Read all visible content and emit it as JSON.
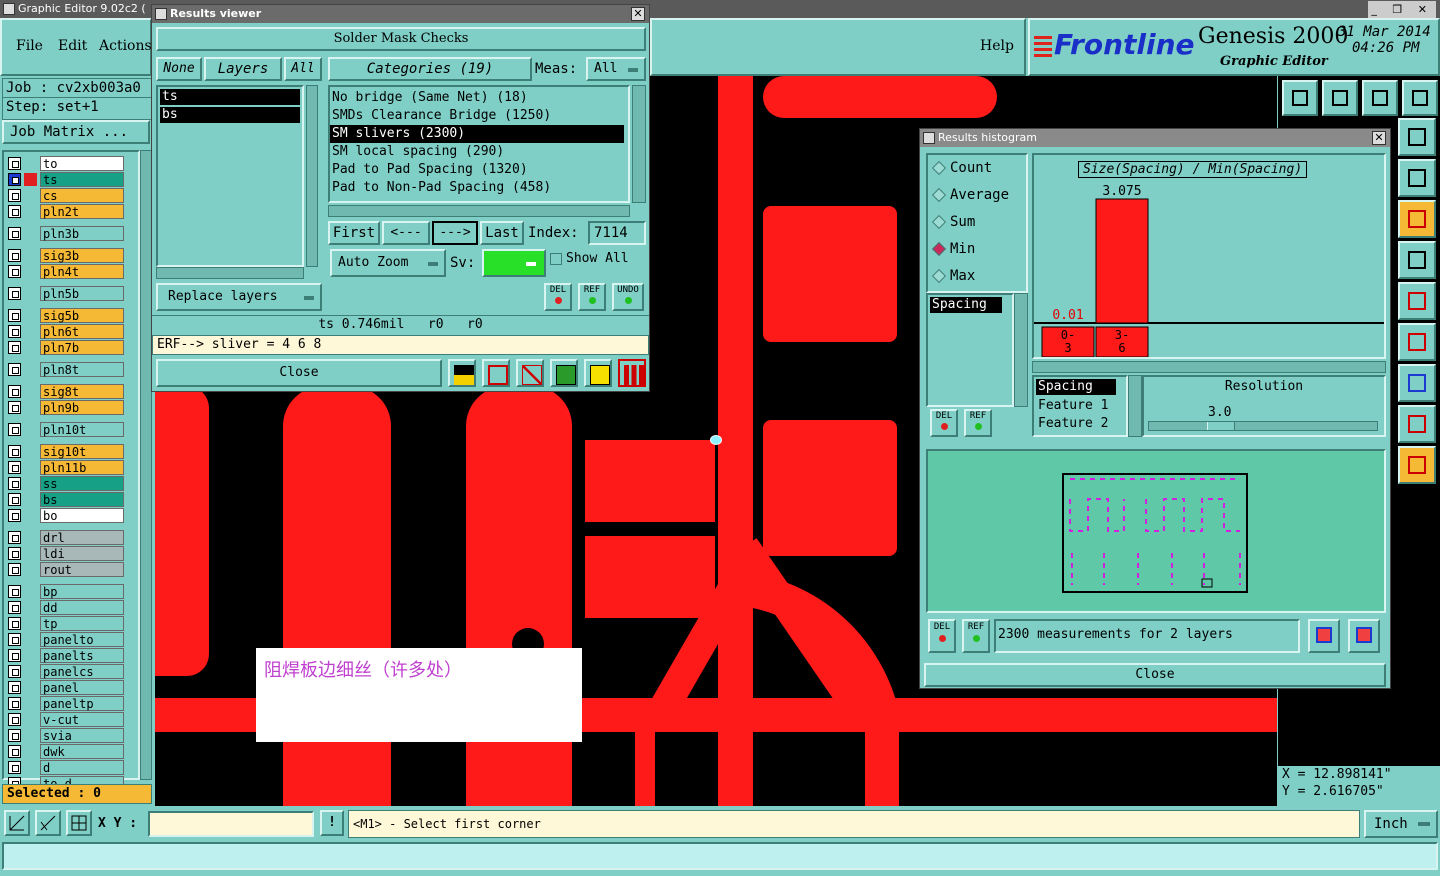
{
  "app": {
    "title": "Graphic Editor 9.02c2 (",
    "help": "Help",
    "menu": [
      "File",
      "Edit",
      "Actions"
    ],
    "job": "Job : cv2xb003a0",
    "step": "Step: set+1",
    "job_matrix": "Job Matrix ...",
    "brand": "Frontline",
    "product": "Genesis 2000",
    "subtitle": "Graphic Editor",
    "date": "31 Mar 2014",
    "time": "04:26 PM",
    "selected": "Selected : 0",
    "xy_label": "X Y :",
    "prompt": "<M1> - Select first corner",
    "unit": "Inch",
    "coord_x": "X = 12.898141\"",
    "coord_y": "Y = 2.616705\"",
    "annotation": "阻焊板边细丝（许多处）"
  },
  "layers": [
    {
      "name": "to",
      "color": "#ffffff"
    },
    {
      "name": "ts",
      "color": "#16a085"
    },
    {
      "name": "cs",
      "color": "#f5b935"
    },
    {
      "name": "pln2t",
      "color": "#f5b935"
    },
    {
      "name": "pln3b",
      "color": "#7fcfc6"
    },
    {
      "name": "sig3b",
      "color": "#f5b935"
    },
    {
      "name": "pln4t",
      "color": "#f5b935"
    },
    {
      "name": "pln5b",
      "color": "#7fcfc6"
    },
    {
      "name": "sig5b",
      "color": "#f5b935"
    },
    {
      "name": "pln6t",
      "color": "#f5b935"
    },
    {
      "name": "pln7b",
      "color": "#f5b935"
    },
    {
      "name": "pln8t",
      "color": "#7fcfc6"
    },
    {
      "name": "sig8t",
      "color": "#f5b935"
    },
    {
      "name": "pln9b",
      "color": "#f5b935"
    },
    {
      "name": "pln10t",
      "color": "#7fcfc6"
    },
    {
      "name": "sig10t",
      "color": "#f5b935"
    },
    {
      "name": "pln11b",
      "color": "#f5b935"
    },
    {
      "name": "ss",
      "color": "#16a085"
    },
    {
      "name": "bs",
      "color": "#16a085"
    },
    {
      "name": "bo",
      "color": "#ffffff"
    },
    {
      "name": "drl",
      "color": "#a8b8b8"
    },
    {
      "name": "ldi",
      "color": "#a8b8b8"
    },
    {
      "name": "rout",
      "color": "#a8b8b8"
    },
    {
      "name": "bp",
      "color": "#7fcfc6"
    },
    {
      "name": "dd",
      "color": "#7fcfc6"
    },
    {
      "name": "tp",
      "color": "#7fcfc6"
    },
    {
      "name": "panelto",
      "color": "#7fcfc6"
    },
    {
      "name": "panelts",
      "color": "#7fcfc6"
    },
    {
      "name": "panelcs",
      "color": "#7fcfc6"
    },
    {
      "name": "panel",
      "color": "#7fcfc6"
    },
    {
      "name": "paneltp",
      "color": "#7fcfc6"
    },
    {
      "name": "v-cut",
      "color": "#7fcfc6"
    },
    {
      "name": "svia",
      "color": "#7fcfc6"
    },
    {
      "name": "dwk",
      "color": "#7fcfc6"
    },
    {
      "name": "d",
      "color": "#7fcfc6"
    },
    {
      "name": "to.d",
      "color": "#7fcfc6"
    }
  ],
  "results_viewer": {
    "title": "Results viewer",
    "header": "Solder Mask Checks",
    "none": "None",
    "layers": "Layers",
    "all": "All",
    "categories": "Categories (19)",
    "meas_label": "Meas:",
    "meas_value": "All",
    "layer_list": [
      "ts",
      "bs"
    ],
    "category_list": [
      "No bridge (Same Net) (18)",
      "SMDs Clearance Bridge (1250)",
      "SM slivers (2300)",
      "SM local spacing (290)",
      "Pad to Pad Spacing (1320)",
      "Pad to Non-Pad Spacing (458)"
    ],
    "selected_category": "SM slivers (2300)",
    "first": "First",
    "prev": "<---",
    "next": "--->",
    "last": "Last",
    "index_label": "Index:",
    "index_value": "7114",
    "auto_zoom": "Auto Zoom",
    "sv_label": "Sv:",
    "show_all": "Show All",
    "replace_layers": "Replace layers",
    "del": "DEL",
    "ref": "REF",
    "undo": "UNDO",
    "status": "ts 0.746mil   r0   r0",
    "erf": "ERF--> sliver = 4 6 8",
    "close": "Close"
  },
  "results_histogram": {
    "title": "Results histogram",
    "options": [
      "Count",
      "Average",
      "Sum",
      "Min",
      "Max"
    ],
    "selected_option": "Min",
    "chart_title": "Size(Spacing) / Min(Spacing)",
    "bar_value": "3.075",
    "low_value": "0.01",
    "bin_labels": [
      "0-\n3",
      "3-\n6"
    ],
    "measure": "Spacing",
    "feature_list": [
      "Spacing",
      "Feature 1",
      "Feature 2"
    ],
    "resolution_label": "Resolution",
    "resolution_value": "3.0",
    "summary": "2300 measurements for 2 layers",
    "close": "Close",
    "del": "DEL",
    "ref": "REF"
  },
  "chart_data": {
    "type": "bar",
    "title": "Size(Spacing) / Min(Spacing)",
    "categories": [
      "0-3",
      "3-6"
    ],
    "values": [
      0.01,
      3.075
    ],
    "color": "#ff1a1a"
  },
  "colors": {
    "teal": "#7fcfc6",
    "red": "#ff1a1a",
    "black": "#000000",
    "tbar": "#6b6b6b"
  }
}
